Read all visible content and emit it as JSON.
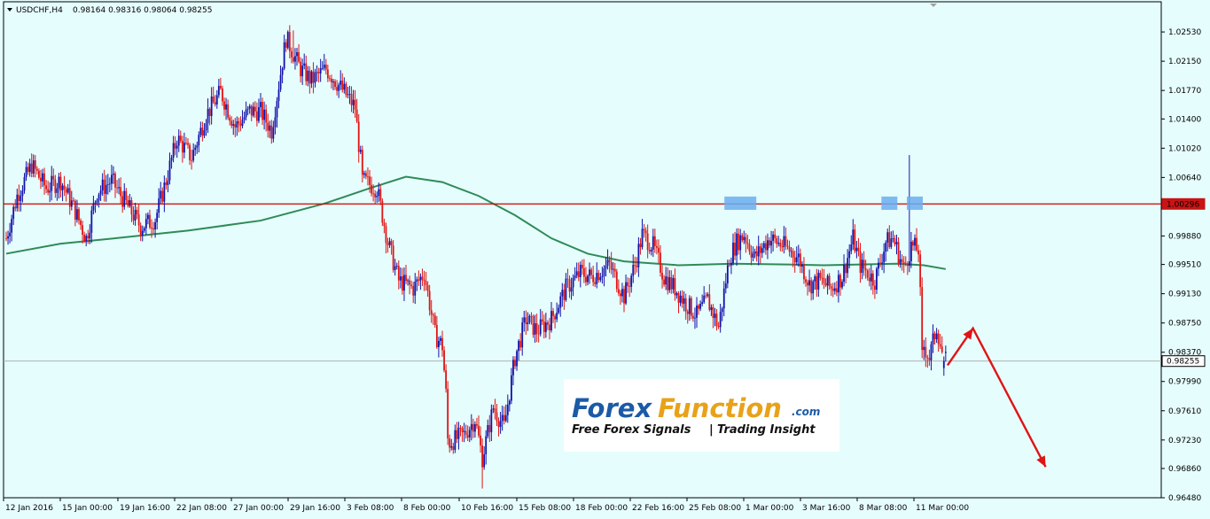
{
  "header": {
    "symbol": "USDCHF,H4",
    "ohlc": "0.98164 0.98316 0.98064 0.98255"
  },
  "watermark": {
    "brand_a": "Forex",
    "brand_b": "Function",
    "brand_suffix": ".com",
    "tagline_a": "Free Forex Signals",
    "tagline_sep": "|",
    "tagline_b": "Trading Insight"
  },
  "chart_data": {
    "type": "candlestick",
    "ylim": [
      0.9648,
      1.0283
    ],
    "y_ticks": [
      "1.02530",
      "1.02150",
      "1.01770",
      "1.01400",
      "1.01020",
      "1.00640",
      "0.99880",
      "0.99510",
      "0.99130",
      "0.98750",
      "0.98370",
      "0.97990",
      "0.97610",
      "0.97230",
      "0.96860",
      "0.96480"
    ],
    "y_tick_values": [
      1.0253,
      1.0215,
      1.0177,
      1.014,
      1.0102,
      1.0064,
      0.9988,
      0.9951,
      0.9913,
      0.9875,
      0.9837,
      0.9799,
      0.9761,
      0.9723,
      0.9686,
      0.9648
    ],
    "x_labels": [
      "12 Jan 2016",
      "15 Jan 00:00",
      "19 Jan 16:00",
      "22 Jan 08:00",
      "27 Jan 00:00",
      "29 Jan 16:00",
      "3 Feb 08:00",
      "8 Feb 00:00",
      "10 Feb 16:00",
      "15 Feb 08:00",
      "18 Feb 00:00",
      "22 Feb 16:00",
      "25 Feb 08:00",
      "1 Mar 00:00",
      "3 Mar 16:00",
      "8 Mar 08:00",
      "11 Mar 00:00"
    ],
    "resistance_level": {
      "value": 1.00296,
      "label": "1.00296",
      "color": "#cc0000"
    },
    "current_price": {
      "value": 0.98255,
      "label": "0.98255"
    },
    "moving_average": {
      "color": "#2e8b57",
      "points": [
        [
          0,
          0.9965
        ],
        [
          30,
          0.9978
        ],
        [
          60,
          0.9985
        ],
        [
          100,
          0.9995
        ],
        [
          140,
          1.0008
        ],
        [
          175,
          1.003
        ],
        [
          200,
          1.005
        ],
        [
          220,
          1.0065
        ],
        [
          240,
          1.0058
        ],
        [
          260,
          1.004
        ],
        [
          280,
          1.0015
        ],
        [
          300,
          0.9985
        ],
        [
          320,
          0.9965
        ],
        [
          340,
          0.9955
        ],
        [
          370,
          0.995
        ],
        [
          400,
          0.9952
        ],
        [
          430,
          0.9951
        ],
        [
          450,
          0.995
        ],
        [
          470,
          0.9951
        ],
        [
          490,
          0.9952
        ],
        [
          505,
          0.995
        ],
        [
          517,
          0.9945
        ]
      ]
    },
    "series_colors": {
      "bull": "#1212a8",
      "bear": "#e01414"
    },
    "candles": [],
    "markers": [
      {
        "i": 404,
        "level": 1.003
      },
      {
        "i": 486,
        "level": 1.003
      },
      {
        "i": 500,
        "level": 1.003
      }
    ],
    "projection": {
      "color": "#e01414",
      "points": [
        [
          518,
          0.982
        ],
        [
          532,
          0.9868
        ],
        [
          572,
          0.9688
        ]
      ]
    }
  }
}
